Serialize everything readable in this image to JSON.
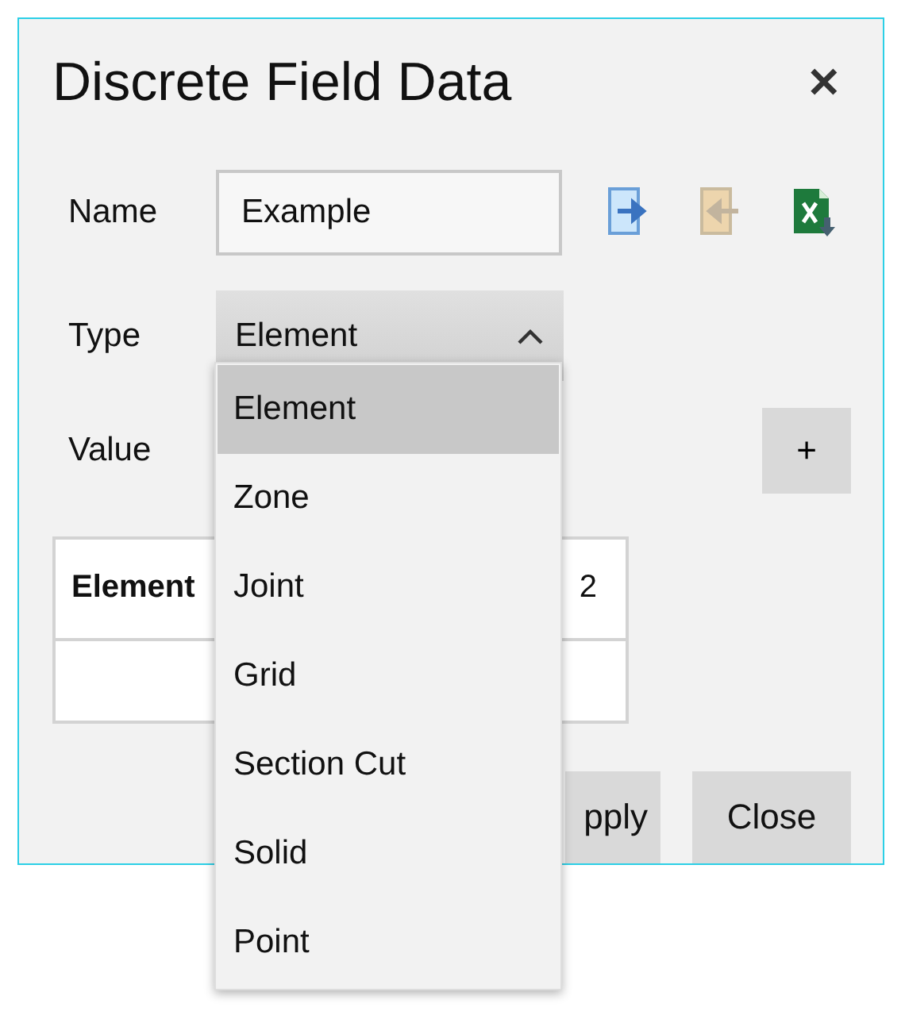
{
  "window": {
    "title": "Discrete Field Data",
    "close": "✕"
  },
  "name_field": {
    "label": "Name",
    "value": "Example"
  },
  "toolbar": [
    {
      "kind": "import",
      "disabled": false
    },
    {
      "kind": "export",
      "disabled": true
    },
    {
      "kind": "excel",
      "disabled": false
    }
  ],
  "type_field": {
    "label": "Type",
    "value": "Element",
    "expanded": true
  },
  "value_field": {
    "label": "Value",
    "add": "+"
  },
  "table": {
    "columns": [
      "Element",
      "2"
    ]
  },
  "dropdown": [
    {
      "label": "Element",
      "selected": true
    },
    {
      "label": "Zone",
      "selected": false
    },
    {
      "label": "Joint",
      "selected": false
    },
    {
      "label": "Grid",
      "selected": false
    },
    {
      "label": "Section Cut",
      "selected": false
    },
    {
      "label": "Solid",
      "selected": false
    },
    {
      "label": "Point",
      "selected": false
    }
  ],
  "buttons": [
    "pply",
    "Close"
  ]
}
